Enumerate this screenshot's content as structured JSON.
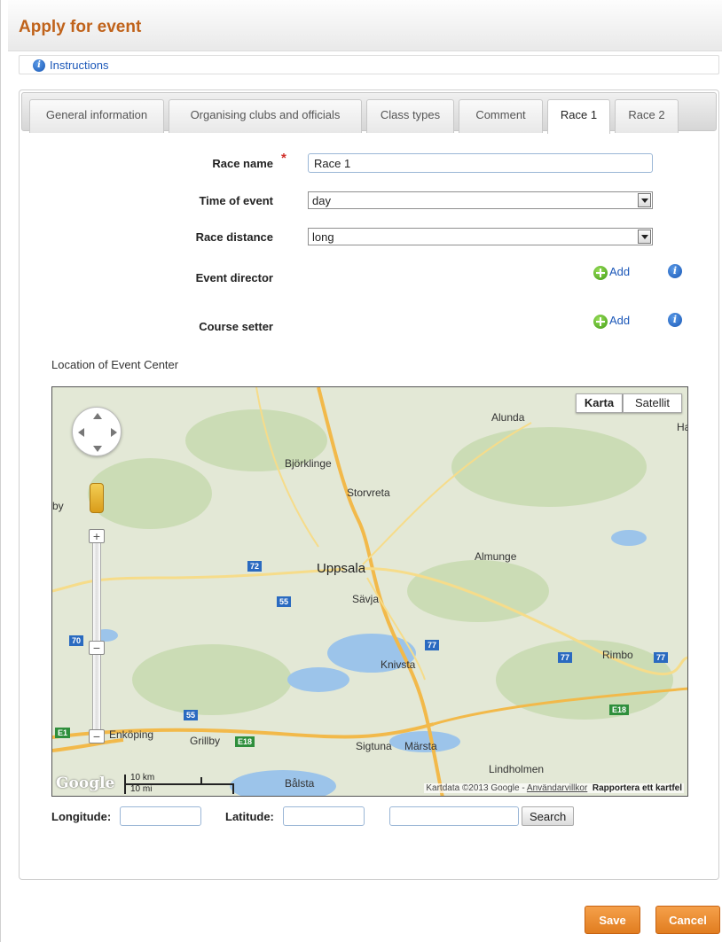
{
  "page": {
    "title": "Apply for event",
    "instructions_link": "Instructions"
  },
  "tabs": [
    {
      "label": "General information"
    },
    {
      "label": "Organising clubs and officials"
    },
    {
      "label": "Class types"
    },
    {
      "label": "Comment"
    },
    {
      "label": "Race 1",
      "active": true
    },
    {
      "label": "Race 2"
    }
  ],
  "form": {
    "race_name_label": "Race name",
    "race_name_value": "Race 1",
    "time_of_event_label": "Time of event",
    "time_of_event_value": "day",
    "race_distance_label": "Race distance",
    "race_distance_value": "long",
    "event_director_label": "Event director",
    "course_setter_label": "Course setter",
    "add_label": "Add",
    "location_label": "Location of Event Center"
  },
  "map": {
    "type_map": "Karta",
    "type_satellite": "Satellit",
    "places": {
      "alunda": "Alunda",
      "ha": "Ha",
      "bjorklinge": "Björklinge",
      "storvreta": "Storvreta",
      "by": "by",
      "uppsala": "Uppsala",
      "almunge": "Almunge",
      "savja": "Sävja",
      "knivsta": "Knivsta",
      "rimbo": "Rimbo",
      "enkoping": "Enköping",
      "grillby": "Grillby",
      "sigtuna": "Sigtuna",
      "marsta": "Märsta",
      "lindholmen": "Lindholmen",
      "balsta": "Bålsta"
    },
    "shields": {
      "r72": "72",
      "r55a": "55",
      "r70": "70",
      "r55b": "55",
      "r77a": "77",
      "r77b": "77",
      "r77c": "77",
      "e18a": "E18",
      "e18b": "E18",
      "e1": "E1"
    },
    "logo": "Google",
    "scale_km": "10 km",
    "scale_mi": "10 mi",
    "attribution_prefix": "Kartdata ©2013 Google - ",
    "attribution_terms": "Användarvillkor",
    "attribution_report": "Rapportera ett kartfel"
  },
  "coords": {
    "longitude_label": "Longitude:",
    "latitude_label": "Latitude:",
    "longitude_value": "",
    "latitude_value": "",
    "search_value": "",
    "search_button": "Search"
  },
  "actions": {
    "save": "Save",
    "cancel": "Cancel"
  }
}
